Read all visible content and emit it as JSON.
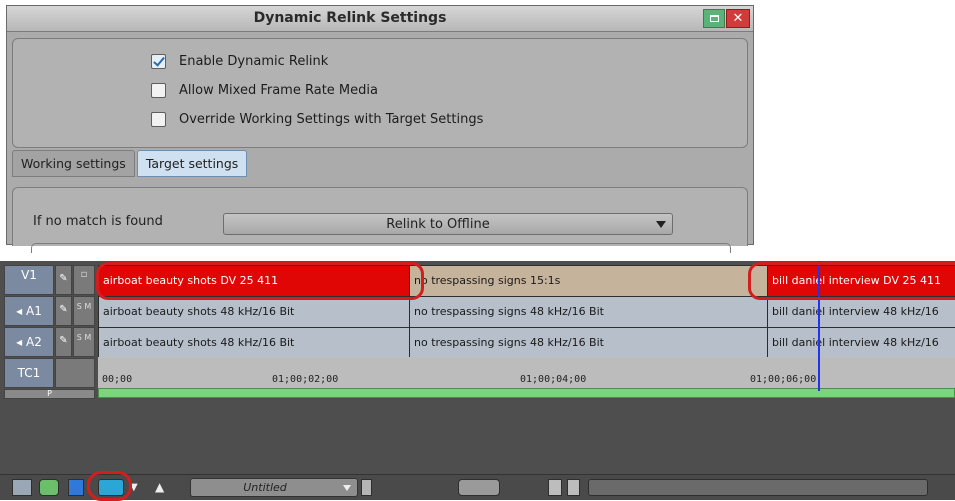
{
  "dialog": {
    "title": "Dynamic Relink Settings",
    "close_glyph": "✕",
    "options": [
      {
        "label": "Enable Dynamic Relink",
        "checked": true
      },
      {
        "label": "Allow Mixed Frame Rate Media",
        "checked": false
      },
      {
        "label": "Override Working Settings with Target Settings",
        "checked": false
      }
    ],
    "tabs": [
      {
        "label": "Working settings",
        "active": false
      },
      {
        "label": "Target settings",
        "active": true
      }
    ],
    "no_match_label": "If no match is found",
    "no_match_value": "Relink to Offline"
  },
  "timeline": {
    "tracks": [
      {
        "name": "V1",
        "btn": "✎",
        "extra": "▫"
      },
      {
        "name": "◂ A1",
        "btn": "✎",
        "extra": "S M"
      },
      {
        "name": "◂ A2",
        "btn": "✎",
        "extra": "S M"
      },
      {
        "name": "TC1",
        "btn": "",
        "extra": ""
      },
      {
        "name": "P",
        "btn": "",
        "extra": ""
      }
    ],
    "v1_clips": [
      "airboat beauty shots  DV 25 411",
      "no trespassing signs  15:1s",
      "bill daniel interview  DV 25 411"
    ],
    "a1_clips": [
      "airboat beauty shots  48 kHz/16 Bit",
      "no trespassing signs  48 kHz/16 Bit",
      "bill daniel interview  48 kHz/16"
    ],
    "a2_clips": [
      "airboat beauty shots  48 kHz/16 Bit",
      "no trespassing signs  48 kHz/16 Bit",
      "bill daniel interview  48 kHz/16"
    ],
    "timecodes": [
      "00;00",
      "01;00;02;00",
      "01;00;04;00",
      "01;00;06;00"
    ]
  },
  "toolbar": {
    "sequence_name": "Untitled"
  },
  "colors": {
    "offline_clip": "#e10606",
    "highlight_circle": "#d21e1e",
    "playhead": "#2233ee"
  }
}
